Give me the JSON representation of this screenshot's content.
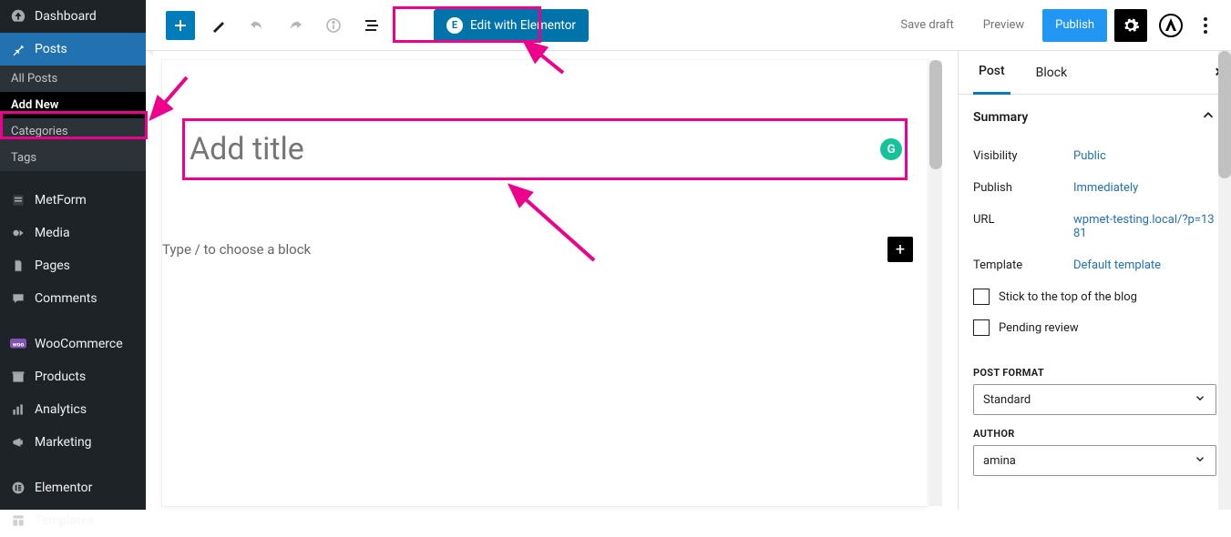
{
  "colors": {
    "highlight": "#ec008c",
    "accent_blue": "#2271b1",
    "elementor_blue": "#0073aa",
    "publish_blue": "#2196f3"
  },
  "sidebar": {
    "items": [
      {
        "label": "Dashboard",
        "icon": "gauge-icon"
      },
      {
        "label": "Posts",
        "icon": "pin-icon",
        "current": true,
        "submenu": [
          {
            "label": "All Posts"
          },
          {
            "label": "Add New",
            "current": true
          },
          {
            "label": "Categories"
          },
          {
            "label": "Tags"
          }
        ]
      },
      {
        "label": "MetForm",
        "icon": "form-icon"
      },
      {
        "label": "Media",
        "icon": "media-icon"
      },
      {
        "label": "Pages",
        "icon": "page-icon"
      },
      {
        "label": "Comments",
        "icon": "comment-icon"
      },
      {
        "label": "WooCommerce",
        "icon": "woo-icon"
      },
      {
        "label": "Products",
        "icon": "archive-icon"
      },
      {
        "label": "Analytics",
        "icon": "bars-icon"
      },
      {
        "label": "Marketing",
        "icon": "megaphone-icon"
      },
      {
        "label": "Elementor",
        "icon": "elementor-icon"
      },
      {
        "label": "Templates",
        "icon": "templates-icon"
      }
    ]
  },
  "toolbar": {
    "add_block_tooltip": "Add block",
    "elementor_label": "Edit with Elementor",
    "save_draft": "Save draft",
    "preview": "Preview",
    "publish": "Publish"
  },
  "editor": {
    "title_placeholder": "Add title",
    "block_prompt": "Type / to choose a block"
  },
  "settings": {
    "tabs": {
      "post": "Post",
      "block": "Block"
    },
    "summary_label": "Summary",
    "rows": {
      "visibility": {
        "k": "Visibility",
        "v": "Public"
      },
      "publish": {
        "k": "Publish",
        "v": "Immediately"
      },
      "url": {
        "k": "URL",
        "v": "wpmet-testing.local/?p=1381"
      },
      "template": {
        "k": "Template",
        "v": "Default template"
      }
    },
    "stick_label": "Stick to the top of the blog",
    "pending_label": "Pending review",
    "post_format_label": "POST FORMAT",
    "post_format_value": "Standard",
    "author_label": "AUTHOR",
    "author_value": "amina"
  }
}
